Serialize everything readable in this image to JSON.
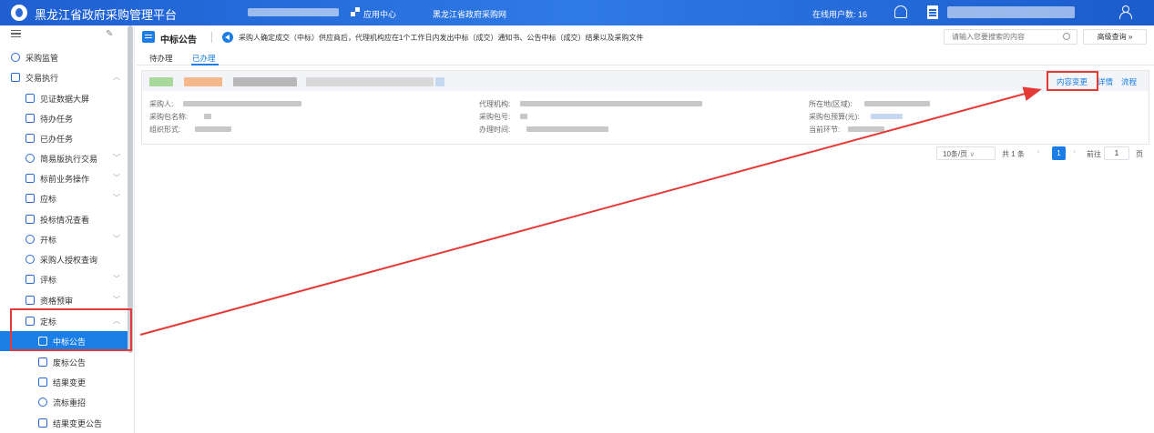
{
  "header": {
    "app_title": "黑龙江省政府采购管理平台",
    "app_center": "应用中心",
    "portal_link": "黑龙江省政府采购网",
    "online_users_label": "在线用户数: 16"
  },
  "sidebar": {
    "items": [
      {
        "label": "采购监管"
      },
      {
        "label": "交易执行"
      },
      {
        "label": "见证数据大屏"
      },
      {
        "label": "待办任务"
      },
      {
        "label": "已办任务"
      },
      {
        "label": "简易版执行交易"
      },
      {
        "label": "标前业务操作"
      },
      {
        "label": "应标"
      },
      {
        "label": "投标情况查看"
      },
      {
        "label": "开标"
      },
      {
        "label": "采购人授权查询"
      },
      {
        "label": "评标"
      },
      {
        "label": "资格预审"
      },
      {
        "label": "定标"
      },
      {
        "label": "中标公告"
      },
      {
        "label": "废标公告"
      },
      {
        "label": "结果变更"
      },
      {
        "label": "流标重招"
      },
      {
        "label": "结果变更公告"
      }
    ]
  },
  "main": {
    "page_title": "中标公告",
    "notice": "采购人确定成交（中标）供应商后，代理机构应在1个工作日内发出中标（成交）通知书、公告中标（成交）结果以及采购文件",
    "search_placeholder": "请输入您要搜索的内容",
    "advanced_search_label": "高级查询",
    "tabs": [
      {
        "label": "待办理"
      },
      {
        "label": "已办理"
      }
    ],
    "row_actions": {
      "content_change": "内容变更",
      "detail": "详情",
      "flow": "流程"
    },
    "fields": {
      "purchaser": "采购人:",
      "agency": "代理机构:",
      "location": "所在地(区域):",
      "package_name": "采购包名称:",
      "package_no": "采购包号:",
      "budget": "采购包预算(元):",
      "org_form": "组织形式:",
      "handle_time": "办理时间:",
      "current_stage": "当前环节:"
    }
  },
  "pager": {
    "page_size": "10条/页",
    "total": "共 1 条",
    "current_page": "1",
    "goto_label": "前往",
    "goto_value": "1",
    "page_unit": "页"
  },
  "colors": {
    "primary": "#1a7ee6",
    "header": "#2a6ad8",
    "highlight": "#e53935"
  }
}
